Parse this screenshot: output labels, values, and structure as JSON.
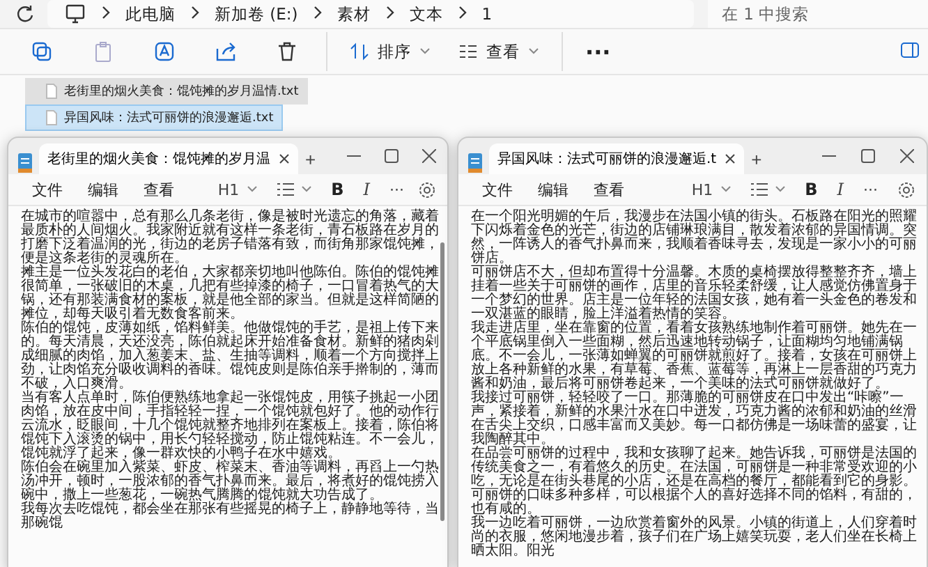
{
  "explorer": {
    "breadcrumbs": [
      "此电脑",
      "新加卷 (E:)",
      "素材",
      "文本",
      "1"
    ],
    "search": {
      "placeholder": "在 1 中搜索"
    },
    "toolbar": {
      "sort": "排序",
      "view": "查看",
      "more": "···"
    },
    "files": [
      {
        "name": "老街里的烟火美食：馄饨摊的岁月温情.txt",
        "selected": false
      },
      {
        "name": "异国风味：法式可丽饼的浪漫邂逅.txt",
        "selected": true
      }
    ]
  },
  "windows": [
    {
      "tab_title": "老街里的烟火美食：馄饨摊的岁月温",
      "new_tab": "+",
      "menu": [
        "文件",
        "编辑",
        "查看"
      ],
      "heading": "H1",
      "bold": "B",
      "italic": "I",
      "more": "···",
      "paragraphs": [
        "在城市的喧嚣中，总有那么几条老街，像是被时光遗忘的角落，藏着最质朴的人间烟火。我家附近就有这样一条老街，青石板路在岁月的打磨下泛着温润的光，街边的老房子错落有致，而街角那家馄饨摊，便是这条老街的灵魂所在。",
        "摊主是一位头发花白的老伯，大家都亲切地叫他陈伯。陈伯的馄饨摊很简单，一张破旧的木桌，几把有些掉漆的椅子，一口冒着热气的大锅，还有那装满食材的案板，就是他全部的家当。但就是这样简陋的摊位，却每天吸引着无数食客前来。",
        "陈伯的馄饨，皮薄如纸，馅料鲜美。他做馄饨的手艺，是祖上传下来的。每天清晨，天还没亮，陈伯就起床开始准备食材。新鲜的猪肉剁成细腻的肉馅，加入葱姜末、盐、生抽等调料，顺着一个方向搅拌上劲，让肉馅充分吸收调料的香味。馄饨皮则是陈伯亲手擀制的，薄而不破，入口爽滑。",
        "当有客人点单时，陈伯便熟练地拿起一张馄饨皮，用筷子挑起一小团肉馅，放在皮中间，手指轻轻一捏，一个馄饨就包好了。他的动作行云流水，眨眼间，十几个馄饨就整齐地排列在案板上。接着，陈伯将馄饨下入滚烫的锅中，用长勺轻轻搅动，防止馄饨粘连。不一会儿，馄饨就浮了起来，像一群欢快的小鸭子在水中嬉戏。",
        "陈伯会在碗里加入紫菜、虾皮、榨菜末、香油等调料，再舀上一勺热汤冲开，顿时，一股浓郁的香气扑鼻而来。最后，将煮好的馄饨捞入碗中，撒上一些葱花，一碗热气腾腾的馄饨就大功告成了。",
        "我每次去吃馄饨，都会坐在那张有些摇晃的椅子上，静静地等待，当那碗馄"
      ]
    },
    {
      "tab_title": "异国风味：法式可丽饼的浪漫邂逅.t",
      "new_tab": "+",
      "menu": [
        "文件",
        "编辑",
        "查看"
      ],
      "heading": "H1",
      "bold": "B",
      "italic": "I",
      "more": "···",
      "paragraphs": [
        "在一个阳光明媚的午后，我漫步在法国小镇的街头。石板路在阳光的照耀下闪烁着金色的光芒，街边的店铺琳琅满目，散发着浓郁的异国情调。突然，一阵诱人的香气扑鼻而来，我顺着香味寻去，发现是一家小小的可丽饼店。",
        "可丽饼店不大，但却布置得十分温馨。木质的桌椅摆放得整整齐齐，墙上挂着一些关于可丽饼的画作，店里的音乐轻柔舒缓，让人感觉仿佛置身于一个梦幻的世界。店主是一位年轻的法国女孩，她有着一头金色的卷发和一双湛蓝的眼睛，脸上洋溢着热情的笑容。",
        "我走进店里，坐在靠窗的位置，看着女孩熟练地制作着可丽饼。她先在一个平底锅里倒入一些面糊，然后迅速地转动锅子，让面糊均匀地铺满锅底。不一会儿，一张薄如蝉翼的可丽饼就煎好了。接着，女孩在可丽饼上放上各种新鲜的水果，有草莓、香蕉、蓝莓等，再淋上一层香甜的巧克力酱和奶油，最后将可丽饼卷起来，一个美味的法式可丽饼就做好了。",
        "我接过可丽饼，轻轻咬了一口。那薄脆的可丽饼皮在口中发出“咔嚓”一声，紧接着，新鲜的水果汁水在口中迸发，巧克力酱的浓郁和奶油的丝滑在舌尖上交织，口感丰富而又美妙。每一口都仿佛是一场味蕾的盛宴，让我陶醉其中。",
        "在品尝可丽饼的过程中，我和女孩聊了起来。她告诉我，可丽饼是法国的传统美食之一，有着悠久的历史。在法国，可丽饼是一种非常受欢迎的小吃，无论是在街头巷尾的小店，还是在高档的餐厅，都能看到它的身影。可丽饼的口味多种多样，可以根据个人的喜好选择不同的馅料，有甜的，也有咸的。",
        "我一边吃着可丽饼，一边欣赏着窗外的风景。小镇的街道上，人们穿着时尚的衣服，悠闲地漫步着，孩子们在广场上嬉笑玩耍，老人们坐在长椅上晒太阳。阳光"
      ]
    }
  ]
}
